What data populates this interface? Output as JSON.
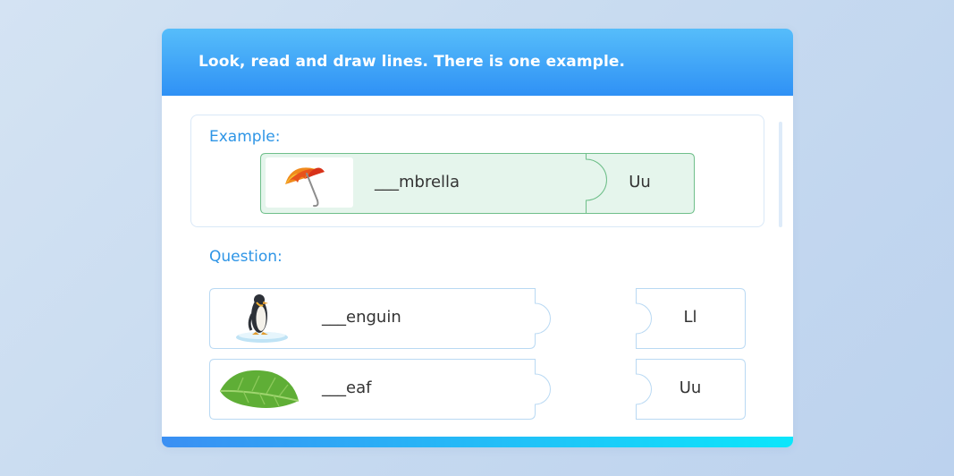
{
  "header": {
    "instruction": "Look, read and draw lines. There is one example."
  },
  "example": {
    "label": "Example:",
    "word": "___mbrella",
    "letter": "Uu",
    "image_icon": "umbrella-icon"
  },
  "question": {
    "label": "Question:",
    "items": [
      {
        "word": "___enguin",
        "image_icon": "penguin-icon"
      },
      {
        "word": "___eaf",
        "image_icon": "leaf-icon"
      }
    ],
    "letters": [
      "Ll",
      "Uu"
    ]
  },
  "colors": {
    "header_top": "#56bdfa",
    "header_bottom": "#2f91f5",
    "label_blue": "#2e95e6",
    "example_fill": "#e5f5ec",
    "example_border": "#6fbf8a",
    "piece_border": "#b9d9f3"
  }
}
